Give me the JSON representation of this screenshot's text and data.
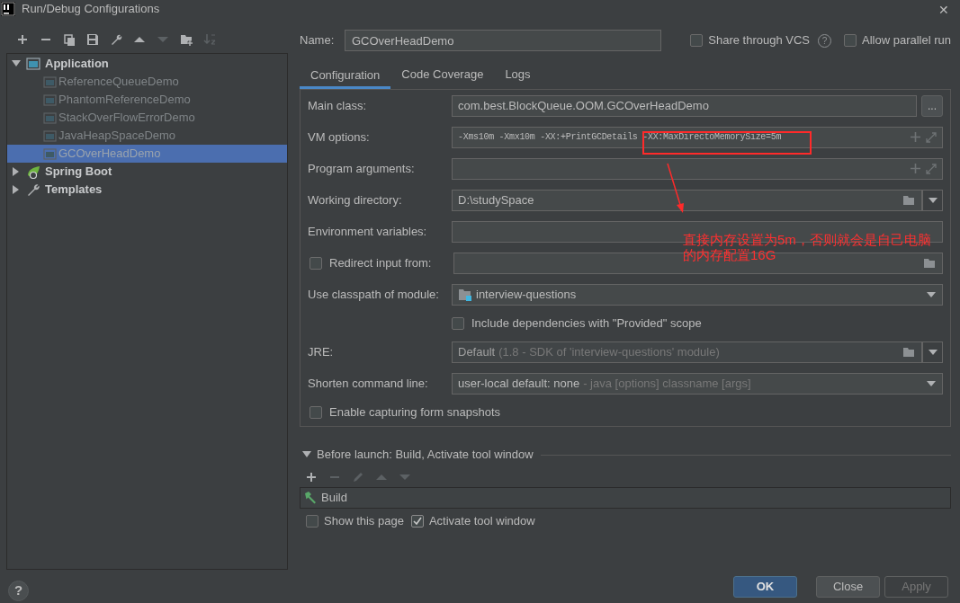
{
  "window": {
    "title": "Run/Debug Configurations",
    "close": "✕"
  },
  "toolbar": [
    {
      "kind": "add",
      "disabled": false
    },
    {
      "kind": "remove",
      "disabled": false
    },
    {
      "kind": "copy",
      "disabled": false
    },
    {
      "kind": "save",
      "disabled": false
    },
    {
      "kind": "wrench",
      "disabled": false
    },
    {
      "kind": "up",
      "disabled": false
    },
    {
      "kind": "down",
      "disabled": true
    },
    {
      "kind": "folder",
      "disabled": false
    },
    {
      "kind": "sort",
      "disabled": true
    }
  ],
  "tree": [
    {
      "label": "Application",
      "kind": "application",
      "expanded": true,
      "selected": false,
      "children": [
        {
          "label": "ReferenceQueueDemo",
          "selected": false
        },
        {
          "label": "PhantomReferenceDemo",
          "selected": false
        },
        {
          "label": "StackOverFlowErrorDemo",
          "selected": false
        },
        {
          "label": "JavaHeapSpaceDemo",
          "selected": false
        },
        {
          "label": "GCOverHeadDemo",
          "selected": true
        }
      ]
    },
    {
      "label": "Spring Boot",
      "kind": "spring",
      "expanded": false,
      "selected": false
    },
    {
      "label": "Templates",
      "kind": "templates",
      "expanded": false,
      "selected": false
    }
  ],
  "name": {
    "label": "Name:",
    "value": "GCOverHeadDemo"
  },
  "help_button": "?",
  "options": [
    {
      "label": "Share through VCS",
      "checked": false,
      "help": "?"
    },
    {
      "label": "Allow parallel run",
      "checked": false
    }
  ],
  "tabs": [
    {
      "label": "Configuration",
      "selected": true
    },
    {
      "label": "Code Coverage",
      "selected": false
    },
    {
      "label": "Logs",
      "selected": false
    }
  ],
  "config": [
    {
      "kind": "text",
      "label": "Main class:",
      "value": "com.best.BlockQueue.OOM.GCOverHeadDemo",
      "button": "..."
    },
    {
      "kind": "expandable",
      "label": "VM options:",
      "value": "-Xms10m -Xmx10m -XX:+PrintGCDetails -XX:MaxDirectoMemorySize=5m"
    },
    {
      "kind": "expandable",
      "label": "Program arguments:"
    },
    {
      "kind": "browse-dropdown",
      "label": "Working directory:",
      "value": "D:\\studySpace",
      "disabled": false
    },
    {
      "kind": "plain",
      "label": "Environment variables:"
    },
    {
      "kind": "checkbox-browse",
      "label": "Redirect input from:",
      "checked": false
    },
    {
      "kind": "module",
      "label": "Use classpath of module:",
      "value": "interview-questions"
    },
    {
      "kind": "checkbox-field",
      "label": "Include dependencies with \"Provided\" scope",
      "checked": false
    },
    {
      "kind": "browse-dropdown",
      "label": "JRE:",
      "value": "Default",
      "hint": "(1.8 - SDK of 'interview-questions' module)",
      "disabled": true
    },
    {
      "kind": "dropdown",
      "label": "Shorten command line:",
      "value": "user-local default: none",
      "hint": "- java [options] classname [args]"
    },
    {
      "kind": "checkbox",
      "label": "Enable capturing form snapshots",
      "checked": false
    }
  ],
  "before_launch": {
    "title": "Before launch: Build, Activate tool window",
    "expanded": true,
    "toolbar": [
      {
        "kind": "add",
        "disabled": false
      },
      {
        "kind": "remove",
        "disabled": true
      },
      {
        "kind": "edit",
        "disabled": true
      },
      {
        "kind": "up",
        "disabled": true
      },
      {
        "kind": "down",
        "disabled": true
      }
    ],
    "tasks": [
      {
        "label": "Build"
      }
    ],
    "options": [
      {
        "label": "Show this page",
        "checked": false
      },
      {
        "label": "Activate tool window",
        "checked": true
      }
    ]
  },
  "annotation": {
    "lines": [
      "直接内存设置为5m，否则就会是自己电脑",
      "的内存配置16G"
    ]
  },
  "buttons": [
    {
      "label": "OK",
      "kind": "default",
      "disabled": false
    },
    {
      "label": "Close",
      "kind": "normal",
      "disabled": false
    },
    {
      "label": "Apply",
      "kind": "normal",
      "disabled": true
    }
  ]
}
